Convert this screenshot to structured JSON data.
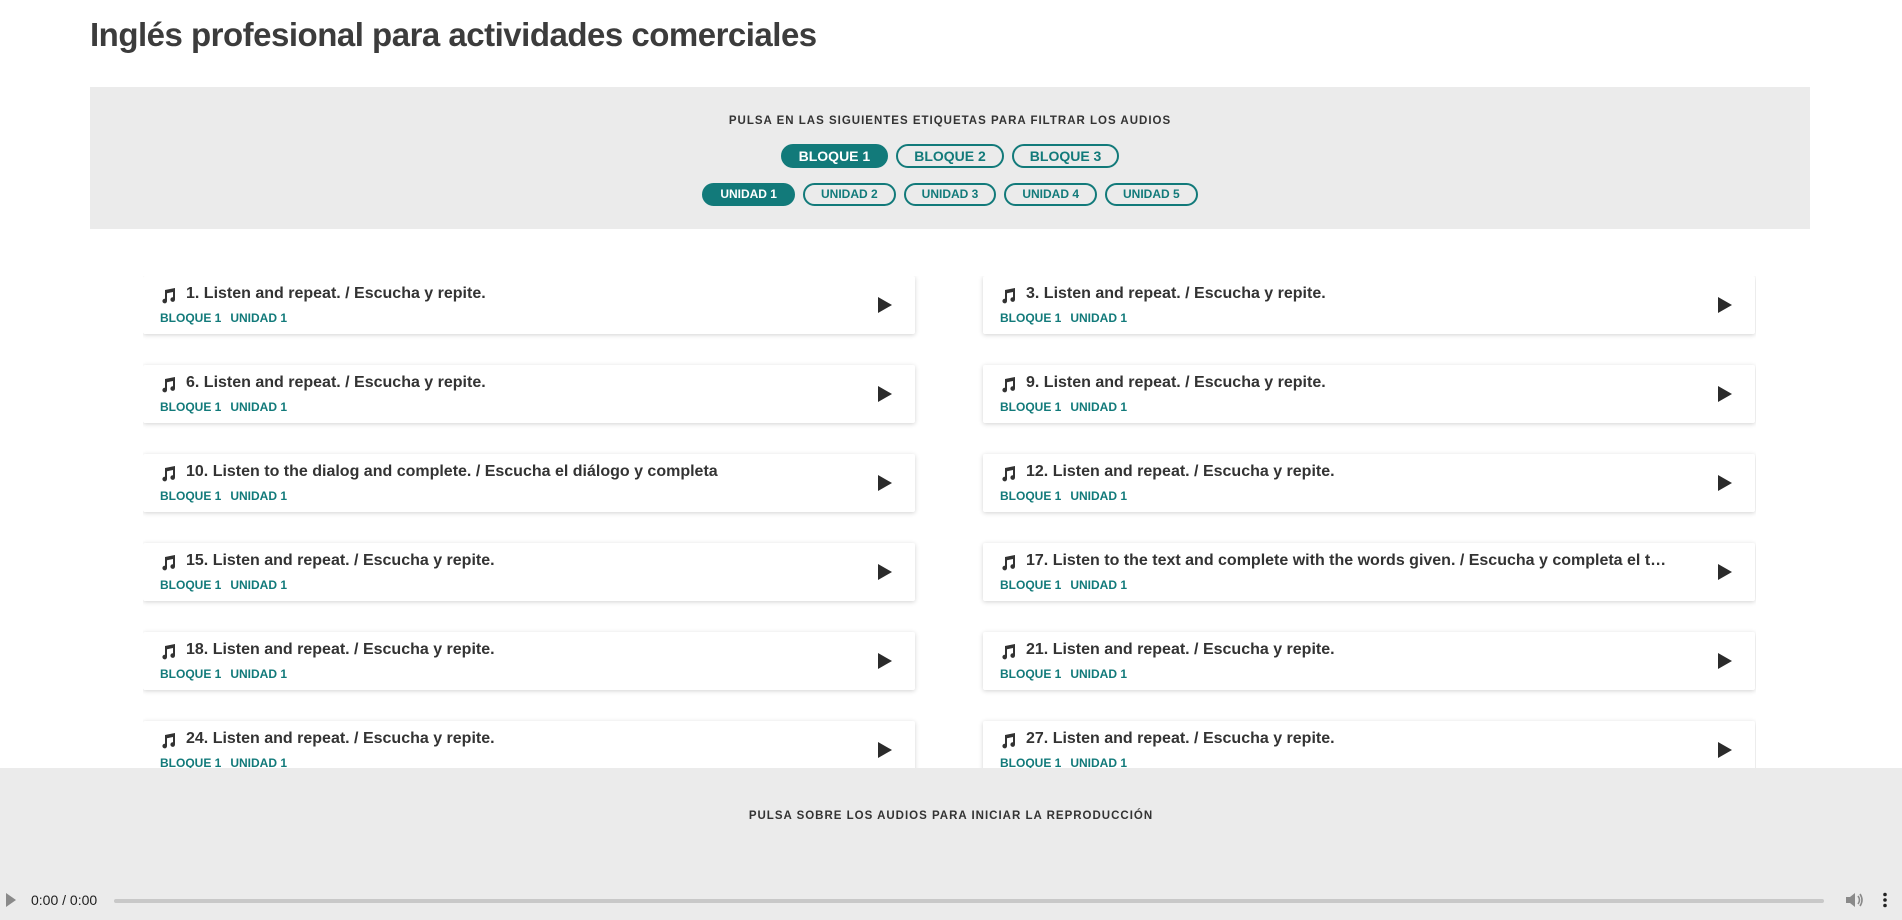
{
  "page": {
    "title": "Inglés profesional para actividades comerciales"
  },
  "filters": {
    "caption": "PULSA EN LAS SIGUIENTES ETIQUETAS PARA FILTRAR LOS AUDIOS",
    "bloques": [
      {
        "label": "BLOQUE 1",
        "active": true
      },
      {
        "label": "BLOQUE 2",
        "active": false
      },
      {
        "label": "BLOQUE 3",
        "active": false
      }
    ],
    "unidades": [
      {
        "label": "UNIDAD 1",
        "active": true
      },
      {
        "label": "UNIDAD 2",
        "active": false
      },
      {
        "label": "UNIDAD 3",
        "active": false
      },
      {
        "label": "UNIDAD 4",
        "active": false
      },
      {
        "label": "UNIDAD 5",
        "active": false
      }
    ]
  },
  "audios": [
    {
      "title": "1. Listen and repeat. / Escucha y repite.",
      "bloque": "BLOQUE 1",
      "unidad": "UNIDAD 1"
    },
    {
      "title": "3. Listen and repeat. / Escucha y repite.",
      "bloque": "BLOQUE 1",
      "unidad": "UNIDAD 1"
    },
    {
      "title": "6. Listen and repeat. / Escucha y repite.",
      "bloque": "BLOQUE 1",
      "unidad": "UNIDAD 1"
    },
    {
      "title": "9. Listen and repeat. / Escucha y repite.",
      "bloque": "BLOQUE 1",
      "unidad": "UNIDAD 1"
    },
    {
      "title": "10. Listen to the dialog and complete. / Escucha el diálogo y completa",
      "bloque": "BLOQUE 1",
      "unidad": "UNIDAD 1"
    },
    {
      "title": "12. Listen and repeat. / Escucha y repite.",
      "bloque": "BLOQUE 1",
      "unidad": "UNIDAD 1"
    },
    {
      "title": "15. Listen and repeat. / Escucha y repite.",
      "bloque": "BLOQUE 1",
      "unidad": "UNIDAD 1"
    },
    {
      "title": "17. Listen to the text and complete with the words given. / Escucha y completa el t…",
      "bloque": "BLOQUE 1",
      "unidad": "UNIDAD 1"
    },
    {
      "title": "18. Listen and repeat. / Escucha y repite.",
      "bloque": "BLOQUE 1",
      "unidad": "UNIDAD 1"
    },
    {
      "title": "21. Listen and repeat. / Escucha y repite.",
      "bloque": "BLOQUE 1",
      "unidad": "UNIDAD 1"
    },
    {
      "title": "24. Listen and repeat. / Escucha y repite.",
      "bloque": "BLOQUE 1",
      "unidad": "UNIDAD 1"
    },
    {
      "title": "27. Listen and repeat. / Escucha y repite.",
      "bloque": "BLOQUE 1",
      "unidad": "UNIDAD 1"
    }
  ],
  "player": {
    "caption": "PULSA SOBRE LOS AUDIOS PARA INICIAR LA REPRODUCCIÓN",
    "time": "0:00 / 0:00",
    "progress": 0,
    "icons": {
      "play": "play-icon",
      "volume": "volume-icon",
      "more": "more-options-icon"
    }
  },
  "colors": {
    "accent": "#127a7a",
    "panel": "#ebebeb",
    "text": "#333333"
  }
}
